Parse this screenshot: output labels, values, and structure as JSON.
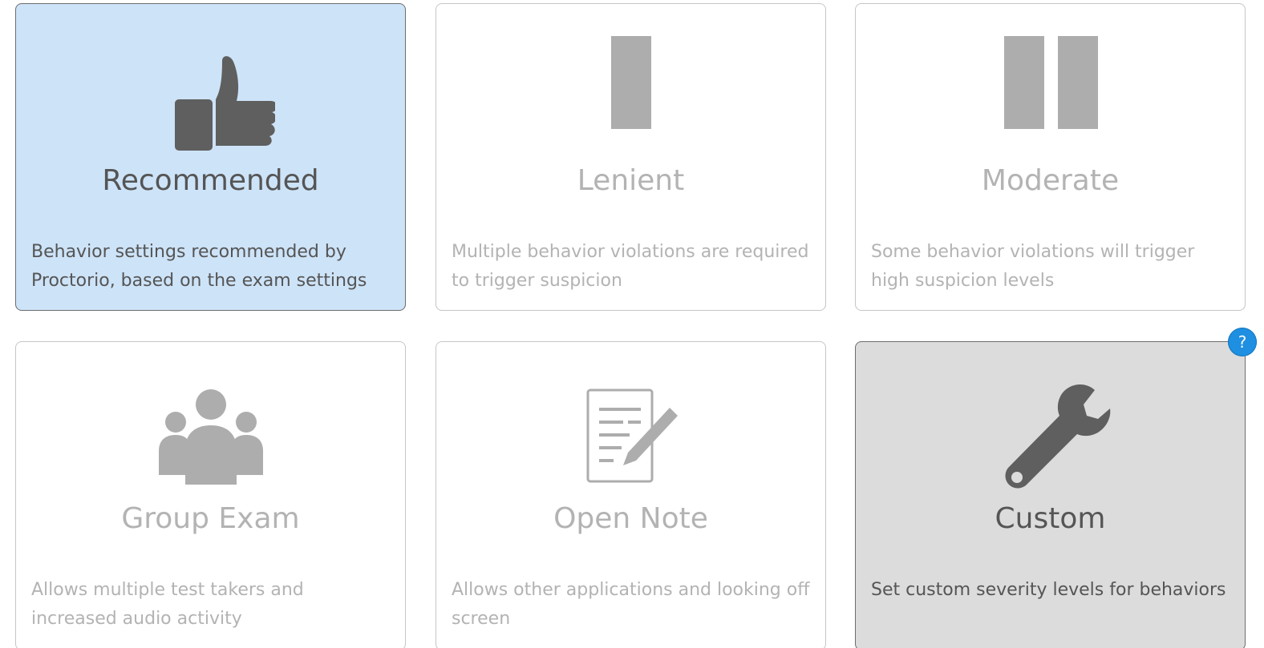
{
  "cards": [
    {
      "id": "recommended",
      "title": "Recommended",
      "description": "Behavior settings recommended by Proctorio, based on the exam settings",
      "icon": "thumbs-up-icon",
      "state": "selected"
    },
    {
      "id": "lenient",
      "title": "Lenient",
      "description": "Multiple behavior violations are required to trigger suspicion",
      "icon": "single-bar-icon",
      "state": "inactive"
    },
    {
      "id": "moderate",
      "title": "Moderate",
      "description": "Some behavior violations will trigger high suspicion levels",
      "icon": "double-bar-icon",
      "state": "inactive"
    },
    {
      "id": "group-exam",
      "title": "Group Exam",
      "description": "Allows multiple test takers and increased audio activity",
      "icon": "group-people-icon",
      "state": "inactive"
    },
    {
      "id": "open-note",
      "title": "Open Note",
      "description": "Allows other applications and looking off screen",
      "icon": "note-pencil-icon",
      "state": "inactive"
    },
    {
      "id": "custom",
      "title": "Custom",
      "description": "Set custom severity levels for behaviors",
      "icon": "wrench-icon",
      "state": "active"
    }
  ],
  "help": {
    "label": "?",
    "icon": "help-icon"
  },
  "colors": {
    "selected_bg": "#cde3f8",
    "active_bg": "#dcdcdc",
    "icon_dark": "#5f5f5f",
    "icon_light": "#adadad",
    "help_badge": "#1e8fe1"
  }
}
